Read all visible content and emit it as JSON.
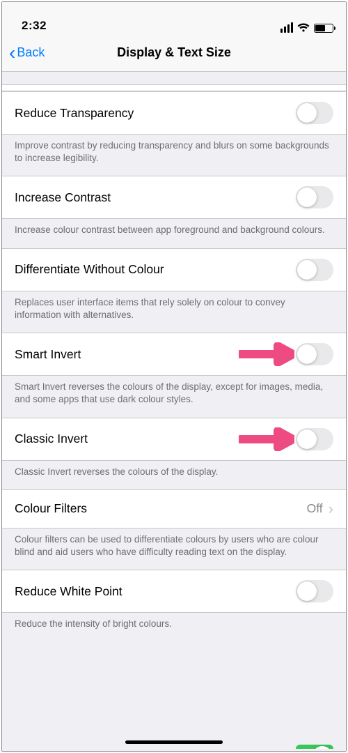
{
  "status": {
    "time": "2:32"
  },
  "nav": {
    "back": "Back",
    "title": "Display & Text Size"
  },
  "rows": {
    "reduce_transparency": {
      "label": "Reduce Transparency",
      "footer": "Improve contrast by reducing transparency and blurs on some backgrounds to increase legibility.",
      "on": false
    },
    "increase_contrast": {
      "label": "Increase Contrast",
      "footer": "Increase colour contrast between app foreground and background colours.",
      "on": false
    },
    "differentiate": {
      "label": "Differentiate Without Colour",
      "footer": "Replaces user interface items that rely solely on colour to convey information with alternatives.",
      "on": false
    },
    "smart_invert": {
      "label": "Smart Invert",
      "footer": "Smart Invert reverses the colours of the display, except for images, media, and some apps that use dark colour styles.",
      "on": false
    },
    "classic_invert": {
      "label": "Classic Invert",
      "footer": "Classic Invert reverses the colours of the display.",
      "on": false
    },
    "colour_filters": {
      "label": "Colour Filters",
      "value": "Off",
      "footer": "Colour filters can be used to differentiate colours by users who are colour blind and aid users who have difficulty reading text on the display."
    },
    "reduce_white_point": {
      "label": "Reduce White Point",
      "footer": "Reduce the intensity of bright colours.",
      "on": false
    }
  },
  "annotation_color": "#ed4b82"
}
